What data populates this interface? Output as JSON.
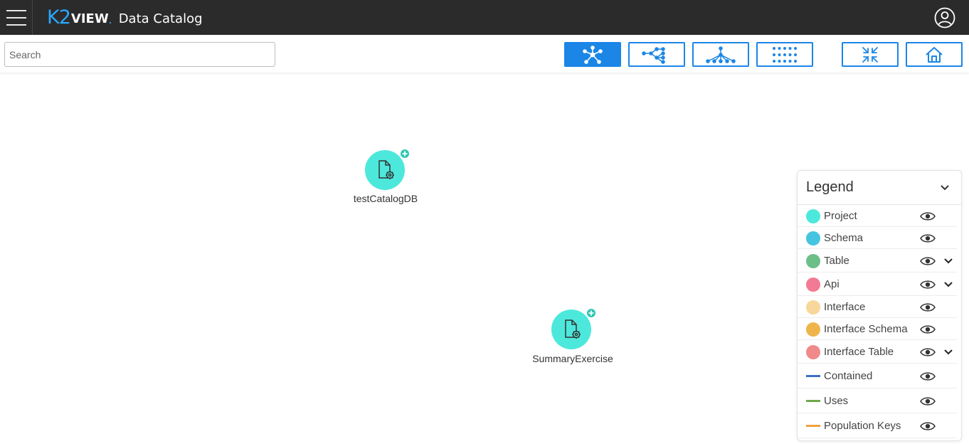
{
  "app": {
    "logo_k2": "K2",
    "logo_view": "VIEW",
    "logo_dot": ".",
    "title": "Data Catalog"
  },
  "search": {
    "placeholder": "Search",
    "value": ""
  },
  "toolbar": {
    "buttons": [
      {
        "name": "layout-force-button",
        "icon": "hub-network-icon",
        "active": true
      },
      {
        "name": "layout-horizontal-tree-button",
        "icon": "tree-horizontal-icon",
        "active": false
      },
      {
        "name": "layout-vertical-tree-button",
        "icon": "tree-vertical-icon",
        "active": false
      },
      {
        "name": "layout-grid-button",
        "icon": "dot-grid-icon",
        "active": false
      },
      {
        "name": "collapse-button",
        "icon": "collapse-arrows-icon",
        "active": false
      },
      {
        "name": "home-button",
        "icon": "home-icon",
        "active": false
      }
    ]
  },
  "graph": {
    "nodes": [
      {
        "label": "testCatalogDB",
        "type": "Project",
        "icon": "project-file-gear-icon"
      },
      {
        "label": "SummaryExercise",
        "type": "Project",
        "icon": "project-file-gear-icon"
      }
    ]
  },
  "legend": {
    "title": "Legend",
    "items": [
      {
        "label": "Project",
        "kind": "node",
        "color": "#4de8dc",
        "expandable": false
      },
      {
        "label": "Schema",
        "kind": "node",
        "color": "#45c4e0",
        "expandable": false
      },
      {
        "label": "Table",
        "kind": "node",
        "color": "#6dbf88",
        "expandable": true
      },
      {
        "label": "Api",
        "kind": "node",
        "color": "#f27a92",
        "expandable": true
      },
      {
        "label": "Interface",
        "kind": "node",
        "color": "#f7d79a",
        "expandable": false
      },
      {
        "label": "Interface Schema",
        "kind": "node",
        "color": "#efb54a",
        "expandable": false
      },
      {
        "label": "Interface Table",
        "kind": "node",
        "color": "#f08a8a",
        "expandable": true
      },
      {
        "label": "Contained",
        "kind": "edge",
        "color": "#3e6fc4",
        "expandable": false
      },
      {
        "label": "Uses",
        "kind": "edge",
        "color": "#6ea94a",
        "expandable": false
      },
      {
        "label": "Population Keys",
        "kind": "edge",
        "color": "#f2a13e",
        "expandable": false
      }
    ]
  }
}
